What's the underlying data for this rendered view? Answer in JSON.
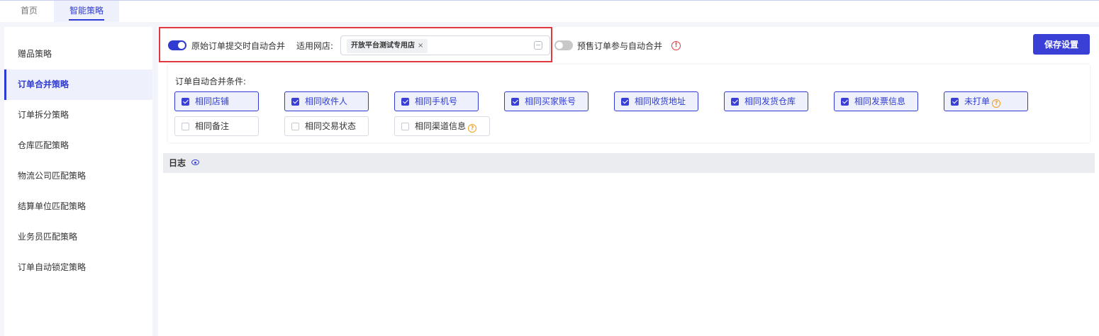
{
  "tabs": [
    {
      "label": "首页",
      "active": false
    },
    {
      "label": "智能策略",
      "active": true
    }
  ],
  "sidebar": {
    "items": [
      {
        "label": "赠品策略",
        "active": false
      },
      {
        "label": "订单合并策略",
        "active": true
      },
      {
        "label": "订单拆分策略",
        "active": false
      },
      {
        "label": "仓库匹配策略",
        "active": false
      },
      {
        "label": "物流公司匹配策略",
        "active": false
      },
      {
        "label": "结算单位匹配策略",
        "active": false
      },
      {
        "label": "业务员匹配策略",
        "active": false
      },
      {
        "label": "订单自动锁定策略",
        "active": false
      }
    ]
  },
  "settings": {
    "auto_merge_label": "原始订单提交时自动合并",
    "auto_merge_on": true,
    "shop_label": "适用网店:",
    "shop_tag": "开放平台测试专用店",
    "shop_tag_remove": "×",
    "presale_label": "预售订单参与自动合并",
    "presale_on": false,
    "presale_info": "!",
    "save_label": "保存设置"
  },
  "conditions": {
    "title": "订单自动合并条件:",
    "items": [
      {
        "label": "相同店铺",
        "checked": true
      },
      {
        "label": "相同收件人",
        "checked": true
      },
      {
        "label": "相同手机号",
        "checked": true
      },
      {
        "label": "相同买家账号",
        "checked": true
      },
      {
        "label": "相同收货地址",
        "checked": true
      },
      {
        "label": "相同发货仓库",
        "checked": true
      },
      {
        "label": "相同发票信息",
        "checked": true
      },
      {
        "label": "未打单",
        "checked": true,
        "help": "?"
      },
      {
        "label": "相同备注",
        "checked": false
      },
      {
        "label": "相同交易状态",
        "checked": false
      },
      {
        "label": "相同渠道信息",
        "checked": false,
        "help": "?"
      }
    ]
  },
  "log": {
    "label": "日志"
  },
  "colors": {
    "accent": "#3a40d6",
    "highlight": "#e0393e",
    "help": "#f0a020"
  }
}
